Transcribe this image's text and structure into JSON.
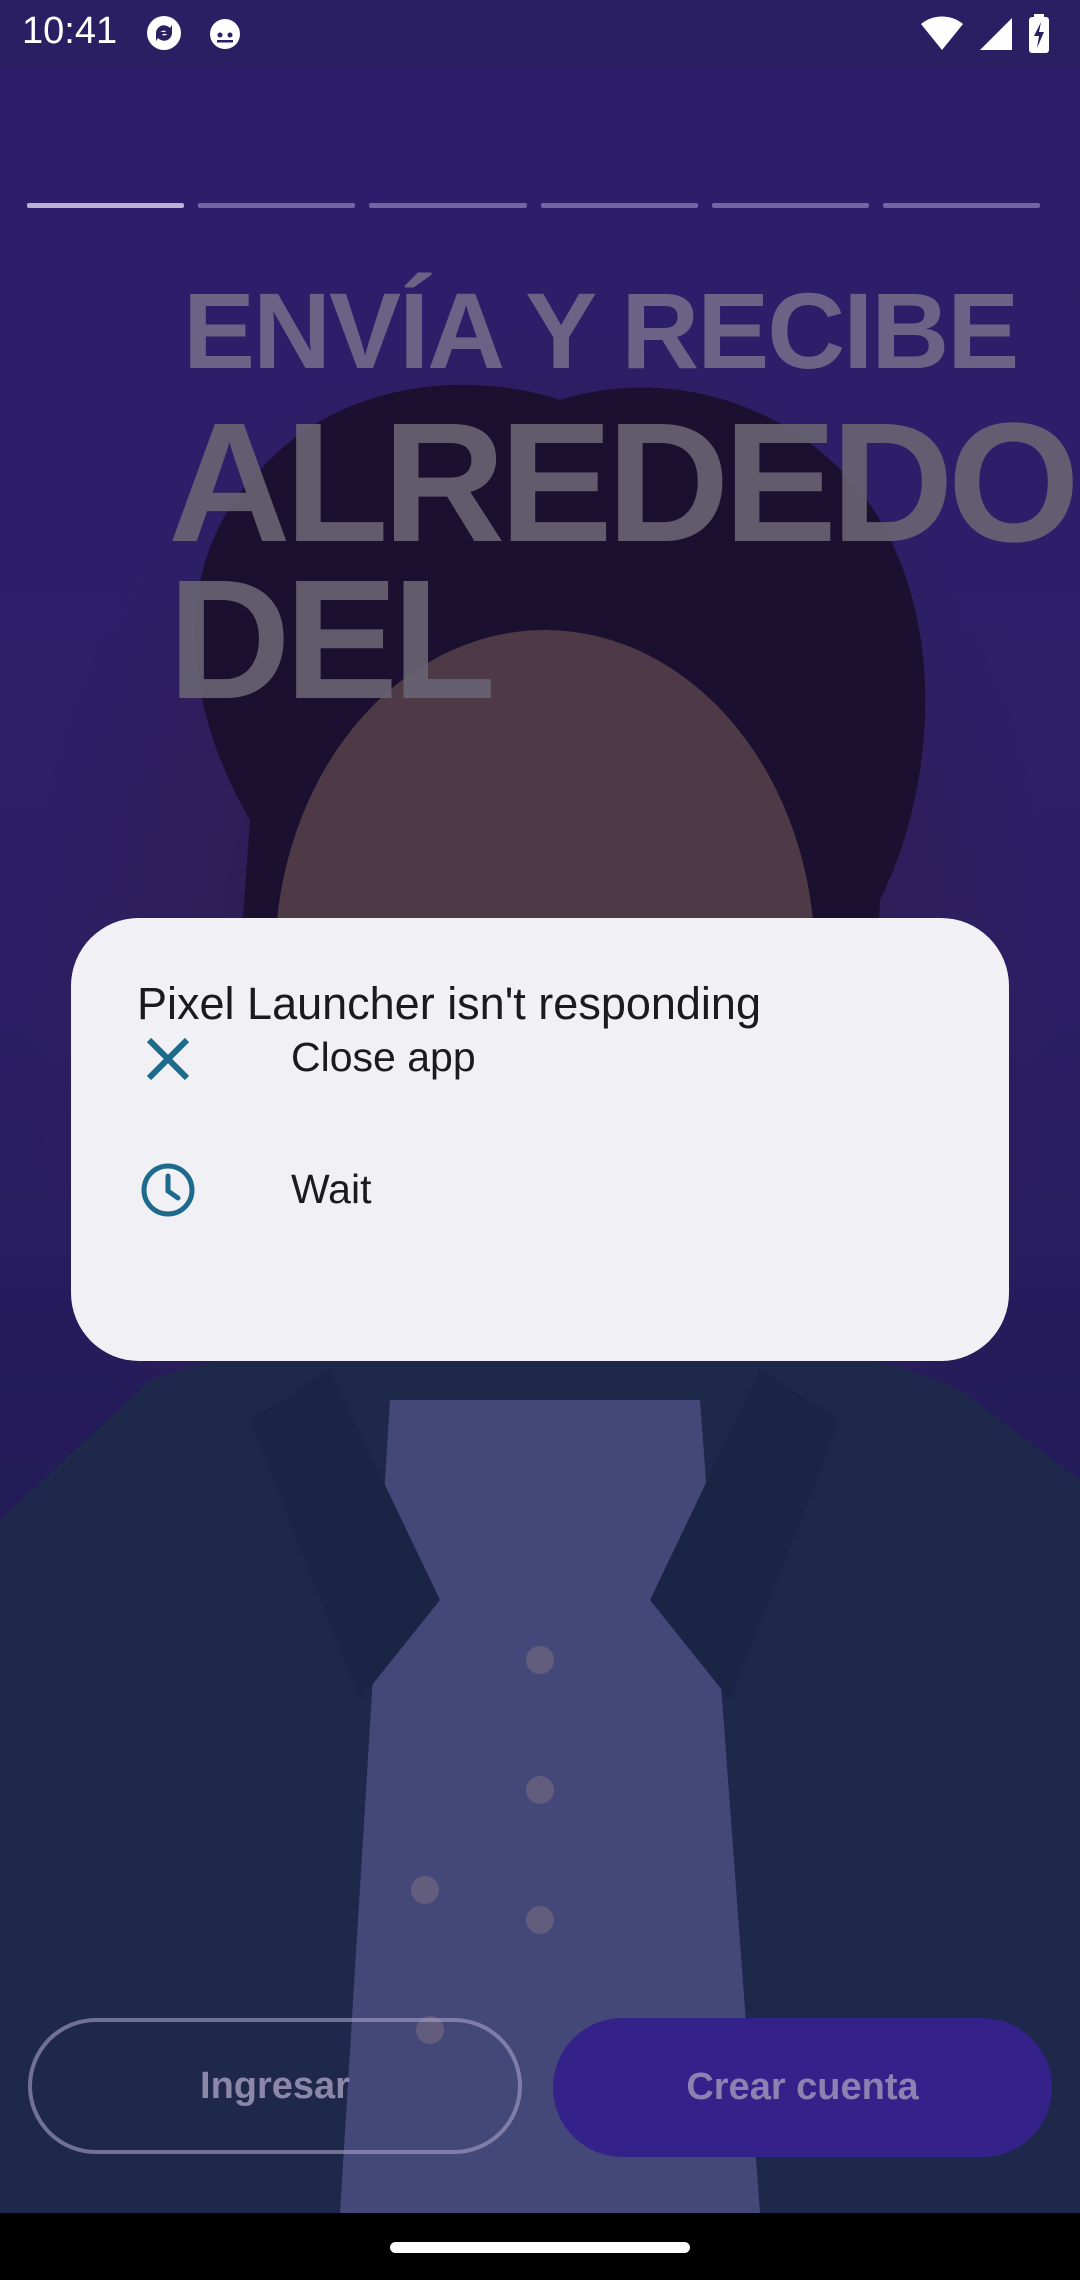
{
  "status_bar": {
    "time": "10:41",
    "notification_icons": [
      "sync-app-icon",
      "cat-app-icon"
    ],
    "system_icons": [
      "wifi-icon",
      "cell-signal-icon",
      "battery-charging-icon"
    ]
  },
  "background_app": {
    "progress_segments": 6,
    "progress_active_index": 0,
    "headline_line1": "ENVÍA Y RECIBE",
    "headline_line2": "ALREDEDO",
    "headline_line3": "DEL",
    "login_button": "Ingresar",
    "signup_button": "Crear cuenta"
  },
  "dialog": {
    "title": "Pixel Launcher isn't responding",
    "options": [
      {
        "label": "Close app",
        "icon": "close-icon"
      },
      {
        "label": "Wait",
        "icon": "clock-icon"
      }
    ]
  },
  "colors": {
    "dialog_bg": "#f1f0f5",
    "icon_accent": "#1c6b8c",
    "primary_purple": "#34228a"
  }
}
